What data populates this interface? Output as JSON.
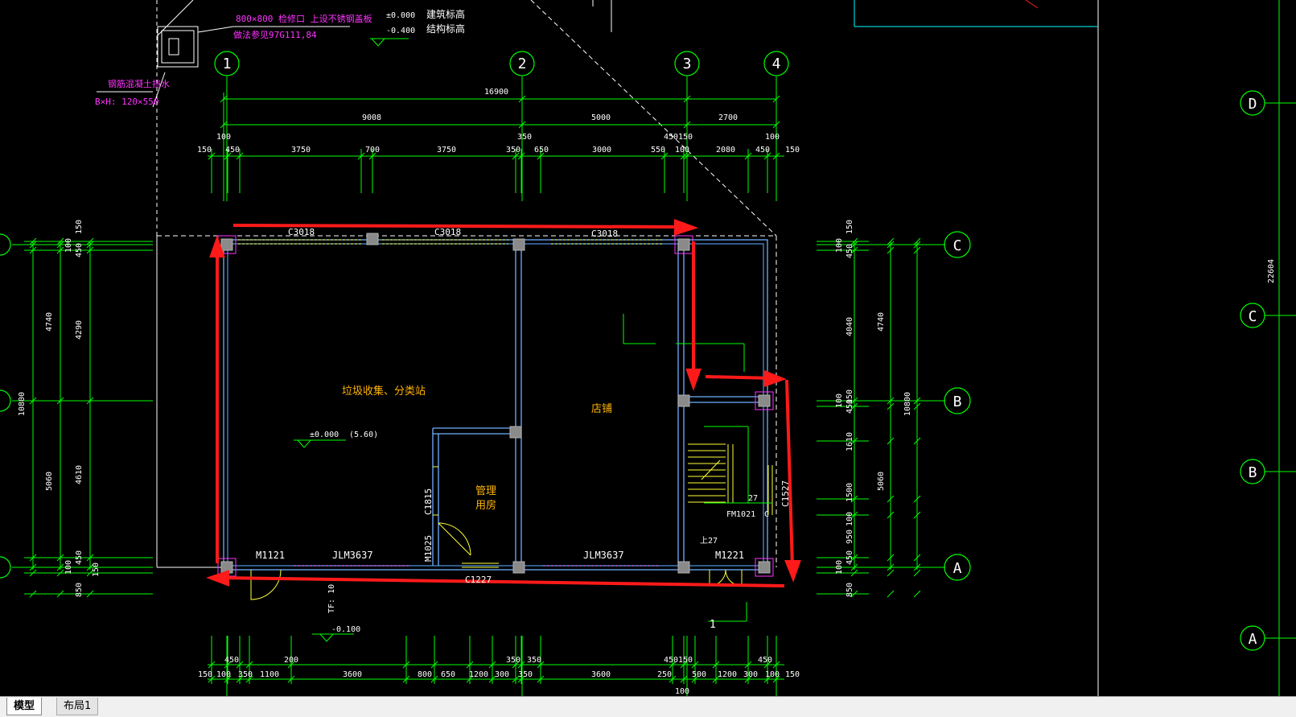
{
  "tabs": [
    {
      "label": "模型",
      "active": true
    },
    {
      "label": "布局1",
      "active": false
    }
  ],
  "colors": {
    "dim": "#00ff00",
    "wall": "#6fb0ff",
    "annotation_magenta": "#ff33ff",
    "label_orange": "#ffb300",
    "white": "#ffffff",
    "red_marker": "#ff1a1a",
    "cyan": "#00ffff",
    "window_yellow": "#ffff33"
  },
  "notes": {
    "top_title": "800×800 检修口 上设不锈钢盖板",
    "top_ref": "做法参见97G111,84",
    "beam_title": "钢筋混凝土挡水",
    "beam_size": "B×H: 120×550",
    "level_1": "±0.000",
    "level_1_label": "建筑标高",
    "level_2": "-0.400",
    "level_2_label": "结构标高"
  },
  "axes_top": [
    "1",
    "2",
    "3",
    "4"
  ],
  "axes_right": [
    "C",
    "B",
    "A"
  ],
  "axes_far_right": [
    "D",
    "C",
    "B",
    "A"
  ],
  "dims_top": {
    "overall": "16900",
    "row2": [
      "9008",
      "5000",
      "2700"
    ],
    "row3_small": [
      "100",
      "350",
      "450150",
      "100"
    ],
    "row3": [
      "150",
      "450",
      "3750",
      "700",
      "3750",
      "350",
      "650",
      "3000",
      "550",
      "100",
      "2080",
      "450",
      "150"
    ]
  },
  "dims_bottom": {
    "row1": [
      "450",
      "200",
      "350",
      "350",
      "450150",
      "450"
    ],
    "row2": [
      "150",
      "100",
      "350",
      "1100",
      "3600",
      "800",
      "650",
      "1200",
      "300",
      "350",
      "3600",
      "250",
      "500",
      "1200",
      "300",
      "100",
      "150"
    ],
    "row3": [
      "100"
    ]
  },
  "dims_left": {
    "outer": [
      "10800"
    ],
    "mid": [
      "4740",
      "5060"
    ],
    "inner": [
      "150",
      "100",
      "450",
      "4290",
      "4610",
      "450",
      "100",
      "150",
      "850"
    ]
  },
  "dims_right": {
    "outer": [
      "10800"
    ],
    "mid": [
      "4740",
      "5060"
    ],
    "inner": [
      "150",
      "100",
      "450",
      "4040",
      "100",
      "450",
      "150",
      "1610",
      "1500",
      "100",
      "950",
      "450",
      "100",
      "850"
    ],
    "far": [
      "22604"
    ]
  },
  "rooms": {
    "room1": "垃圾收集、分类站",
    "room2": "店铺",
    "room3_line1": "管理",
    "room3_line2": "用房",
    "level": "±0.000",
    "level_extra": "(5.60)",
    "outside_level": "-0.100"
  },
  "tags": {
    "c1": "C3018",
    "c2": "C3018",
    "c3": "C3018",
    "door_left": "M1121",
    "door_right": "M1221",
    "jlm1": "JLM3637",
    "jlm2": "JLM3637",
    "c1227": "C1227",
    "c1815": "C1815",
    "m1025": "M1025",
    "stair_fm": "FM1021",
    "stair_c": "C",
    "c1527": "C1527",
    "stair_up": "上27",
    "stair_27": "27",
    "section": "1",
    "tf": "TF: 10"
  }
}
